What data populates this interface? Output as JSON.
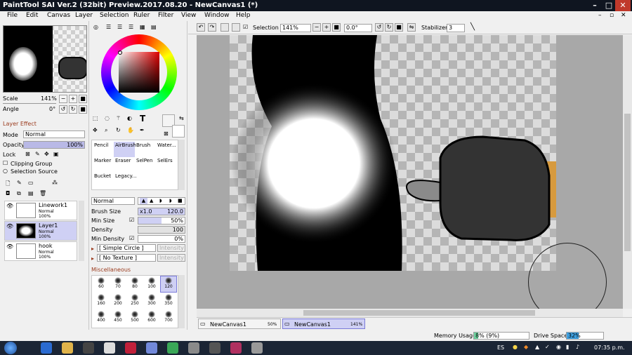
{
  "window": {
    "title": "PaintTool SAI Ver.2 (32bit) Preview.2017.08.20 - NewCanvas1 (*)"
  },
  "menu": [
    "File",
    "Edit",
    "Canvas",
    "Layer",
    "Selection",
    "Ruler",
    "Filter",
    "View",
    "Window",
    "Help"
  ],
  "navigator": {
    "scale_label": "Scale",
    "scale_value": "141%",
    "angle_label": "Angle",
    "angle_value": "0°"
  },
  "layer_effect": {
    "header": "Layer Effect",
    "mode_label": "Mode",
    "mode_value": "Normal",
    "opacity_label": "Opacity",
    "opacity_value": "100%",
    "lock_label": "Lock",
    "clipping_group": "Clipping Group",
    "selection_source": "Selection Source"
  },
  "layers": [
    {
      "name": "Linework1",
      "blend": "Normal",
      "opacity": "100%"
    },
    {
      "name": "Layer1",
      "blend": "Normal",
      "opacity": "100%"
    },
    {
      "name": "hook",
      "blend": "Normal",
      "opacity": "100%"
    }
  ],
  "tools": [
    {
      "label": "Pencil"
    },
    {
      "label": "AirBrush"
    },
    {
      "label": "Brush"
    },
    {
      "label": "Water..."
    },
    {
      "label": "Marker"
    },
    {
      "label": "Eraser"
    },
    {
      "label": "SelPen"
    },
    {
      "label": "SelErs"
    },
    {
      "label": "Bucket"
    },
    {
      "label": "Legacy..."
    }
  ],
  "brush_settings": {
    "blend_mode": "Normal",
    "size_label": "Brush Size",
    "size_mult": "x1.0",
    "size_value": "120.0",
    "min_size_label": "Min Size",
    "min_size_value": "50%",
    "density_label": "Density",
    "density_value": "100",
    "min_density_label": "Min Density",
    "min_density_value": "0%",
    "shape": "[ Simple Circle ]",
    "shape_intensity": "Intensity 50",
    "texture": "[ No Texture ]",
    "texture_intensity": "Intensity 95",
    "misc": "Miscellaneous"
  },
  "brush_presets": [
    "60",
    "70",
    "80",
    "100",
    "120",
    "160",
    "200",
    "250",
    "300",
    "350",
    "400",
    "450",
    "500",
    "600",
    "700"
  ],
  "toolbar": {
    "selection_label": "Selection",
    "zoom_value": "141%",
    "rotate_value": "0.0°",
    "stabilizer_label": "Stabilizer",
    "stabilizer_value": "3"
  },
  "tabs": [
    {
      "name": "NewCanvas1",
      "zoom": "50%"
    },
    {
      "name": "NewCanvas1",
      "zoom": "141%"
    }
  ],
  "status": {
    "memory_label": "Memory Usage",
    "memory_value": "8% (9%)",
    "memory_fraction": 0.08,
    "drive_label": "Drive Space",
    "drive_value": "32%",
    "drive_fraction": 0.32
  },
  "taskbar": {
    "lang": "ES",
    "time": "07:35 p.m."
  },
  "colors": {
    "title_bg": "#0f1520",
    "accent": "#7b7bd8",
    "orange": "#d79a3e",
    "canvas_bg": "#a8a8a8"
  }
}
